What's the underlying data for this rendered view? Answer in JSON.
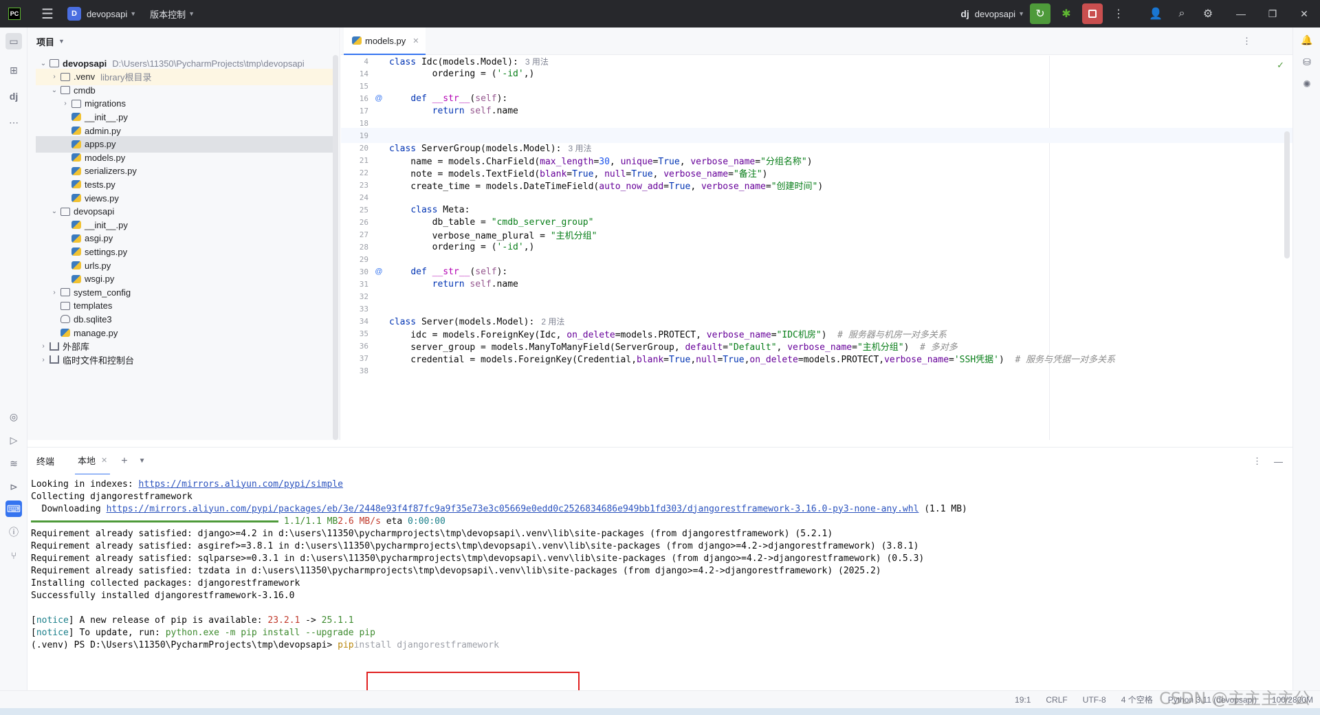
{
  "titlebar": {
    "logo": "PC",
    "project_badge": "D",
    "project_name": "devopsapi",
    "vcs_label": "版本控制",
    "django_label": "dj",
    "run_config": "devopsapi"
  },
  "project": {
    "header": "项目",
    "tree": [
      {
        "label": "devopsapi",
        "extra": "D:\\Users\\11350\\PycharmProjects\\tmp\\devopsapi",
        "icon": "folder",
        "twisty": "open"
      },
      {
        "label": ".venv",
        "extra": "library根目录",
        "icon": "folder",
        "twisty": "closed"
      },
      {
        "label": "cmdb",
        "extra": "",
        "icon": "folder",
        "twisty": "open"
      },
      {
        "label": "migrations",
        "extra": "",
        "icon": "folder",
        "twisty": "closed"
      },
      {
        "label": "__init__.py",
        "extra": "",
        "icon": "py",
        "twisty": ""
      },
      {
        "label": "admin.py",
        "extra": "",
        "icon": "py",
        "twisty": ""
      },
      {
        "label": "apps.py",
        "extra": "",
        "icon": "py",
        "twisty": ""
      },
      {
        "label": "models.py",
        "extra": "",
        "icon": "py",
        "twisty": ""
      },
      {
        "label": "serializers.py",
        "extra": "",
        "icon": "py",
        "twisty": ""
      },
      {
        "label": "tests.py",
        "extra": "",
        "icon": "py",
        "twisty": ""
      },
      {
        "label": "views.py",
        "extra": "",
        "icon": "py",
        "twisty": ""
      },
      {
        "label": "devopsapi",
        "extra": "",
        "icon": "folder",
        "twisty": "open"
      },
      {
        "label": "__init__.py",
        "extra": "",
        "icon": "py",
        "twisty": ""
      },
      {
        "label": "asgi.py",
        "extra": "",
        "icon": "py",
        "twisty": ""
      },
      {
        "label": "settings.py",
        "extra": "",
        "icon": "py",
        "twisty": ""
      },
      {
        "label": "urls.py",
        "extra": "",
        "icon": "py",
        "twisty": ""
      },
      {
        "label": "wsgi.py",
        "extra": "",
        "icon": "py",
        "twisty": ""
      },
      {
        "label": "system_config",
        "extra": "",
        "icon": "folder",
        "twisty": "closed"
      },
      {
        "label": "templates",
        "extra": "",
        "icon": "folder",
        "twisty": ""
      },
      {
        "label": "db.sqlite3",
        "extra": "",
        "icon": "db",
        "twisty": ""
      },
      {
        "label": "manage.py",
        "extra": "",
        "icon": "py",
        "twisty": ""
      },
      {
        "label": "外部库",
        "extra": "",
        "icon": "lib",
        "twisty": "closed"
      },
      {
        "label": "临时文件和控制台",
        "extra": "",
        "icon": "lib",
        "twisty": "closed"
      }
    ]
  },
  "editor": {
    "tab_label": "models.py",
    "lines": [
      {
        "n": "4",
        "html": "<span class=\"kw\">class</span> Idc(models.Model):<span class=\"hint\">3 用法</span>"
      },
      {
        "n": "14",
        "html": "        ordering = (<span class=\"str\">'-id'</span>,)"
      },
      {
        "n": "15",
        "html": ""
      },
      {
        "n": "16",
        "gutter": "@",
        "html": "    <span class=\"kw\">def</span> <span class=\"dunder\">__str__</span>(<span class=\"self\">self</span>):"
      },
      {
        "n": "17",
        "html": "        <span class=\"kw\">return</span> <span class=\"self\">self</span>.name"
      },
      {
        "n": "18",
        "html": ""
      },
      {
        "n": "19",
        "html": "",
        "current": true
      },
      {
        "n": "20",
        "html": "<span class=\"kw\">class</span> ServerGroup(models.Model):<span class=\"hint\">3 用法</span>"
      },
      {
        "n": "21",
        "html": "    name = models.CharField(<span class=\"param\">max_length</span>=<span class=\"num\">30</span>, <span class=\"param\">unique</span>=<span class=\"kw\">True</span>, <span class=\"param\">verbose_name</span>=<span class=\"str\">\"分组名称\"</span>)"
      },
      {
        "n": "22",
        "html": "    note = models.TextField(<span class=\"param\">blank</span>=<span class=\"kw\">True</span>, <span class=\"param\">null</span>=<span class=\"kw\">True</span>, <span class=\"param\">verbose_name</span>=<span class=\"str\">\"备注\"</span>)"
      },
      {
        "n": "23",
        "html": "    create_time = models.DateTimeField(<span class=\"param\">auto_now_add</span>=<span class=\"kw\">True</span>, <span class=\"param\">verbose_name</span>=<span class=\"str\">\"创建时间\"</span>)"
      },
      {
        "n": "24",
        "html": ""
      },
      {
        "n": "25",
        "html": "    <span class=\"kw\">class</span> Meta:"
      },
      {
        "n": "26",
        "html": "        db_table = <span class=\"str\">\"cmdb_server_group\"</span>"
      },
      {
        "n": "27",
        "html": "        verbose_name_plural = <span class=\"str\">\"主机分组\"</span>"
      },
      {
        "n": "28",
        "html": "        ordering = (<span class=\"str\">'-id'</span>,)"
      },
      {
        "n": "29",
        "html": ""
      },
      {
        "n": "30",
        "gutter": "@",
        "html": "    <span class=\"kw\">def</span> <span class=\"dunder\">__str__</span>(<span class=\"self\">self</span>):"
      },
      {
        "n": "31",
        "html": "        <span class=\"kw\">return</span> <span class=\"self\">self</span>.name"
      },
      {
        "n": "32",
        "html": ""
      },
      {
        "n": "33",
        "html": ""
      },
      {
        "n": "34",
        "html": "<span class=\"kw\">class</span> Server(models.Model):<span class=\"hint\">2 用法</span>"
      },
      {
        "n": "35",
        "html": "    idc = models.ForeignKey(Idc, <span class=\"param\">on_delete</span>=models.PROTECT, <span class=\"param\">verbose_name</span>=<span class=\"str\">\"IDC机房\"</span>)  <span class=\"cmt\"># 服务器与机房一对多关系</span>"
      },
      {
        "n": "36",
        "html": "    server_group = models.ManyToManyField(ServerGroup, <span class=\"param\">default</span>=<span class=\"str\">\"Default\"</span>, <span class=\"param\">verbose_name</span>=<span class=\"str\">\"主机分组\"</span>)  <span class=\"cmt\"># 多对多</span>"
      },
      {
        "n": "37",
        "html": "    credential = models.ForeignKey(Credential,<span class=\"param\">blank</span>=<span class=\"kw\">True</span>,<span class=\"param\">null</span>=<span class=\"kw\">True</span>,<span class=\"param\">on_delete</span>=models.PROTECT,<span class=\"param\">verbose_name</span>=<span class=\"str\">'SSH凭据'</span>)  <span class=\"cmt\"># 服务与凭据一对多关系</span>"
      },
      {
        "n": "38",
        "html": ""
      }
    ]
  },
  "terminal": {
    "header_label": "终端",
    "tab_label": "本地",
    "lines": [
      {
        "html": "Looking in indexes: <span class=\"link\">https://mirrors.aliyun.com/pypi/simple</span>"
      },
      {
        "html": "Collecting djangorestframework"
      },
      {
        "html": "  Downloading <span class=\"link\">https://mirrors.aliyun.com/pypi/packages/eb/3e/2448e93f4f87fc9a9f35e73e3c05669e0edd0c2526834686e949bb1fd303/djangorestframework-3.16.0-py3-none-any.whl</span> (1.1 MB)"
      },
      {
        "html": "     <span class=\"progress\"></span><span class=\"tgreen\">1.1/1.1 MB</span> <span class=\"tred\">2.6 MB/s</span> eta <span class=\"tcyan\">0:00:00</span>"
      },
      {
        "html": "Requirement already satisfied: django>=4.2 in d:\\users\\11350\\pycharmprojects\\tmp\\devopsapi\\.venv\\lib\\site-packages (from djangorestframework) (5.2.1)"
      },
      {
        "html": "Requirement already satisfied: asgiref>=3.8.1 in d:\\users\\11350\\pycharmprojects\\tmp\\devopsapi\\.venv\\lib\\site-packages (from django>=4.2->djangorestframework) (3.8.1)"
      },
      {
        "html": "Requirement already satisfied: sqlparse>=0.3.1 in d:\\users\\11350\\pycharmprojects\\tmp\\devopsapi\\.venv\\lib\\site-packages (from django>=4.2->djangorestframework) (0.5.3)"
      },
      {
        "html": "Requirement already satisfied: tzdata in d:\\users\\11350\\pycharmprojects\\tmp\\devopsapi\\.venv\\lib\\site-packages (from django>=4.2->djangorestframework) (2025.2)"
      },
      {
        "html": "Installing collected packages: djangorestframework"
      },
      {
        "html": "Successfully installed djangorestframework-3.16.0"
      },
      {
        "html": ""
      },
      {
        "html": "[<span class=\"tcyan\">notice</span>] A new release of pip is available: <span class=\"tred\">23.2.1</span> -> <span class=\"tgreen\">25.1.1</span>"
      },
      {
        "html": "[<span class=\"tcyan\">notice</span>] To update, run: <span class=\"tgreen\">python.exe -m pip install --upgrade pip</span>"
      },
      {
        "html": "(.venv) PS D:\\Users\\11350\\PycharmProjects\\tmp\\devopsapi> <span class=\"tyellow\">pip</span> <span class=\"tgray\">install djangorestframework</span>"
      }
    ]
  },
  "statusbar": {
    "position": "19:1",
    "line_sep": "CRLF",
    "encoding": "UTF-8",
    "indent": "4 个空格",
    "interpreter": "Python 3.11 (devopsapi)",
    "memory": "100/2800M"
  },
  "watermark": "CSDN @主主主主公"
}
